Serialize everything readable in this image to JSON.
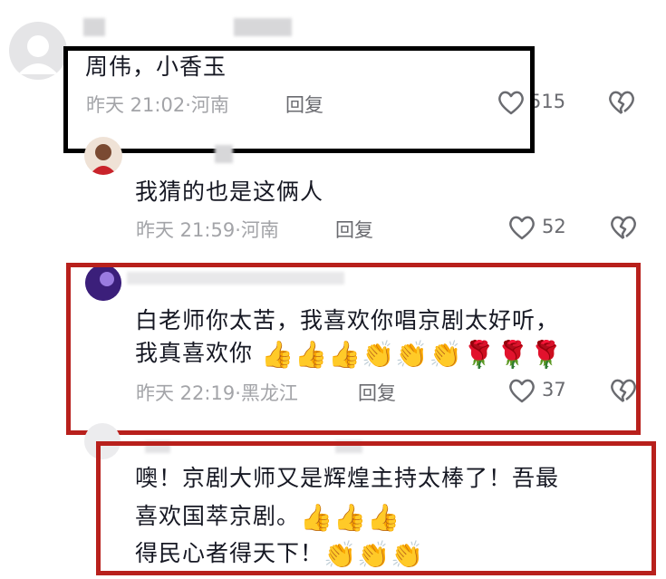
{
  "comments": [
    {
      "text": "周伟，小香玉",
      "time": "昨天 21:02",
      "location": "河南",
      "reply_label": "回复",
      "likes": "515"
    },
    {
      "text": "我猜的也是这俩人",
      "time": "昨天 21:59",
      "location": "河南",
      "reply_label": "回复",
      "likes": "52"
    },
    {
      "line1": "白老师你太苦，我喜欢你唱京剧太好听，",
      "line2": "我真喜欢你",
      "time": "昨天 22:19",
      "location": "黑龙江",
      "reply_label": "回复",
      "likes": "37"
    },
    {
      "line1": "噢！京剧大师又是辉煌主持太棒了！吾最",
      "line2": "喜欢国萃京剧。",
      "line3": "得民心者得天下！"
    }
  ],
  "separator": "·",
  "emojis": {
    "thumbs": "👍",
    "clap": "👏",
    "rose": "🌹"
  },
  "colors": {
    "black_frame": "#000000",
    "red_frame": "#b8201c"
  }
}
